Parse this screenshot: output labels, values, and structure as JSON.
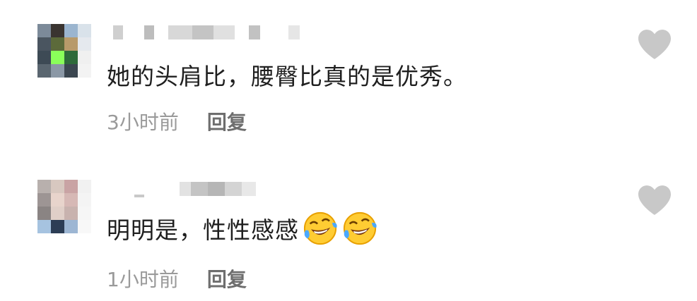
{
  "comments": [
    {
      "text": "她的头肩比，腰臀比真的是优秀。",
      "time": "3小时前",
      "reply_label": "回复",
      "emoji_count": 0
    },
    {
      "text": "明明是，性性感感",
      "time": "1小时前",
      "reply_label": "回复",
      "emoji_count": 2
    }
  ],
  "icons": {
    "like": "heart-icon",
    "emoji": "rolling-on-floor-laughing"
  },
  "colors": {
    "text": "#1f1f1f",
    "time": "#9a9a9a",
    "reply": "#6e6e6e",
    "heart": "#c8c8c8"
  }
}
